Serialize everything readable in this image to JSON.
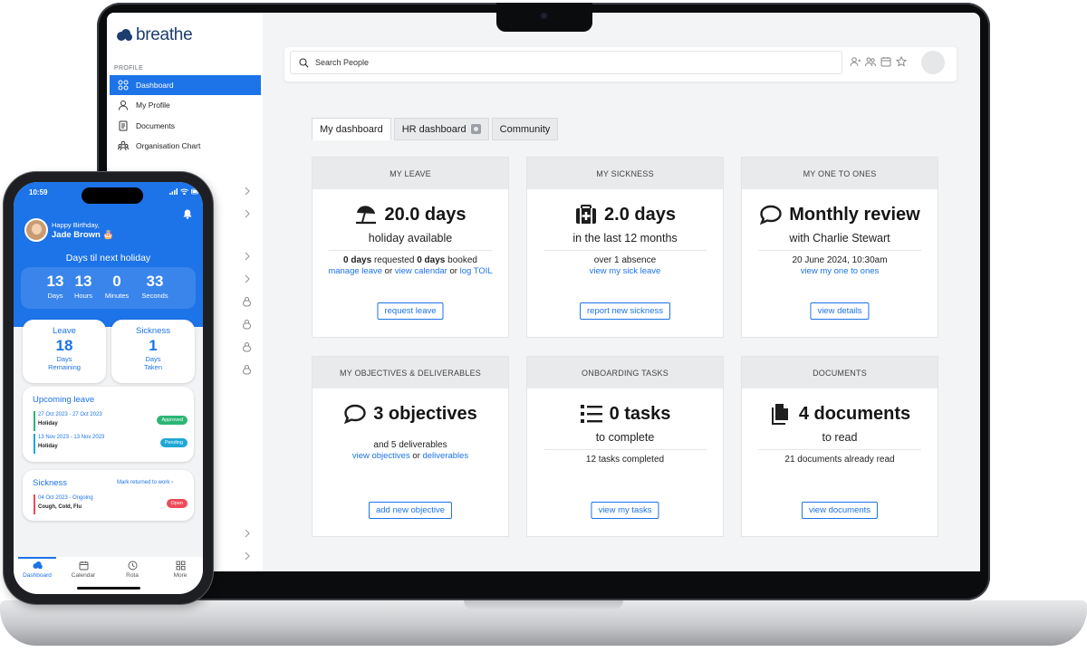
{
  "app": {
    "brand": "breathe",
    "accent_color": "#1d73e8"
  },
  "sidebar": {
    "section_label": "PROFILE",
    "items": [
      {
        "label": "Dashboard",
        "icon": "grid-icon",
        "active": true
      },
      {
        "label": "My Profile",
        "icon": "user-icon",
        "active": false
      },
      {
        "label": "Documents",
        "icon": "document-icon",
        "active": false
      },
      {
        "label": "Organisation Chart",
        "icon": "org-chart-icon",
        "active": false
      }
    ]
  },
  "header": {
    "search_placeholder": "Search People",
    "icons": [
      "person-icon",
      "people-icon",
      "calendar-icon",
      "star-icon"
    ]
  },
  "tabs": [
    {
      "label": "My dashboard",
      "active": true
    },
    {
      "label": "HR dashboard",
      "active": false,
      "has_lock_badge": true
    },
    {
      "label": "Community",
      "active": false
    }
  ],
  "cards": {
    "my_leave": {
      "header": "MY LEAVE",
      "icon": "beach-umbrella-icon",
      "title": "20.0 days",
      "subtitle": "holiday available",
      "line_bold_1": "0 days",
      "line_text_1": " requested ",
      "line_bold_2": "0 days",
      "line_text_2": " booked",
      "link_1": "manage leave",
      "sep_1": " or ",
      "link_2": "view calendar",
      "sep_2": " or ",
      "link_3": "log TOIL",
      "button": "request leave"
    },
    "my_sickness": {
      "header": "MY SICKNESS",
      "icon": "medical-kit-icon",
      "title": "2.0 days",
      "subtitle": "in the last 12 months",
      "line": "over 1 absence",
      "link": "view my sick leave",
      "button": "report new sickness"
    },
    "my_one_to_ones": {
      "header": "MY ONE TO ONES",
      "icon": "speech-bubble-icon",
      "title": "Monthly review",
      "subtitle": "with Charlie Stewart",
      "line": "20 June 2024, 10:30am",
      "link": "view my one to ones",
      "button": "view details"
    },
    "objectives": {
      "header": "MY OBJECTIVES & DELIVERABLES",
      "icon": "speech-bubble-icon",
      "title": "3 objectives",
      "line": "and 5 deliverables",
      "link_1": "view objectives",
      "sep": " or ",
      "link_2": "deliverables",
      "button": "add new objective"
    },
    "onboarding": {
      "header": "ONBOARDING TASKS",
      "icon": "list-icon",
      "title": "0 tasks",
      "subtitle": "to complete",
      "line": "12 tasks completed",
      "button": "view my tasks"
    },
    "documents": {
      "header": "DOCUMENTS",
      "icon": "documents-icon",
      "title": "4 documents",
      "subtitle": "to read",
      "line": "21 documents already read",
      "button": "view documents"
    }
  },
  "phone": {
    "time": "10:59",
    "greeting": "Happy Birthday,",
    "name": "Jade Brown 🎂",
    "countdown_title": "Days til next holiday",
    "countdown": [
      {
        "value": "13",
        "unit": "Days"
      },
      {
        "value": "13",
        "unit": "Hours"
      },
      {
        "value": "0",
        "unit": "Minutes"
      },
      {
        "value": "33",
        "unit": "Seconds"
      }
    ],
    "leave_stat": {
      "title": "Leave",
      "value": "18",
      "line_1": "Days",
      "line_2": "Remaining"
    },
    "sickness_stat": {
      "title": "Sickness",
      "value": "1",
      "line_1": "Days",
      "line_2": "Taken"
    },
    "upcoming": {
      "title": "Upcoming leave",
      "rows": [
        {
          "dates": "27 Oct 2023 - 27 Oct 2023",
          "type": "Holiday",
          "status": "Approved",
          "color": "#2bb673"
        },
        {
          "dates": "13 Nov 2023 - 13 Nov 2023",
          "type": "Holiday",
          "status": "Pending",
          "color": "#1fa7d6"
        }
      ]
    },
    "sickness_card": {
      "title": "Sickness",
      "link": "Mark returned to work",
      "row": {
        "dates": "04 Oct 2023 - Ongoing",
        "type": "Cough, Cold, Flu",
        "status": "Open",
        "color": "#ee4b5a"
      }
    },
    "tabbar": [
      {
        "label": "Dashboard",
        "icon": "cloud-icon",
        "active": true
      },
      {
        "label": "Calendar",
        "icon": "calendar-icon",
        "active": false
      },
      {
        "label": "Rota",
        "icon": "clock-icon",
        "active": false
      },
      {
        "label": "More",
        "icon": "grid-icon",
        "active": false
      }
    ]
  }
}
